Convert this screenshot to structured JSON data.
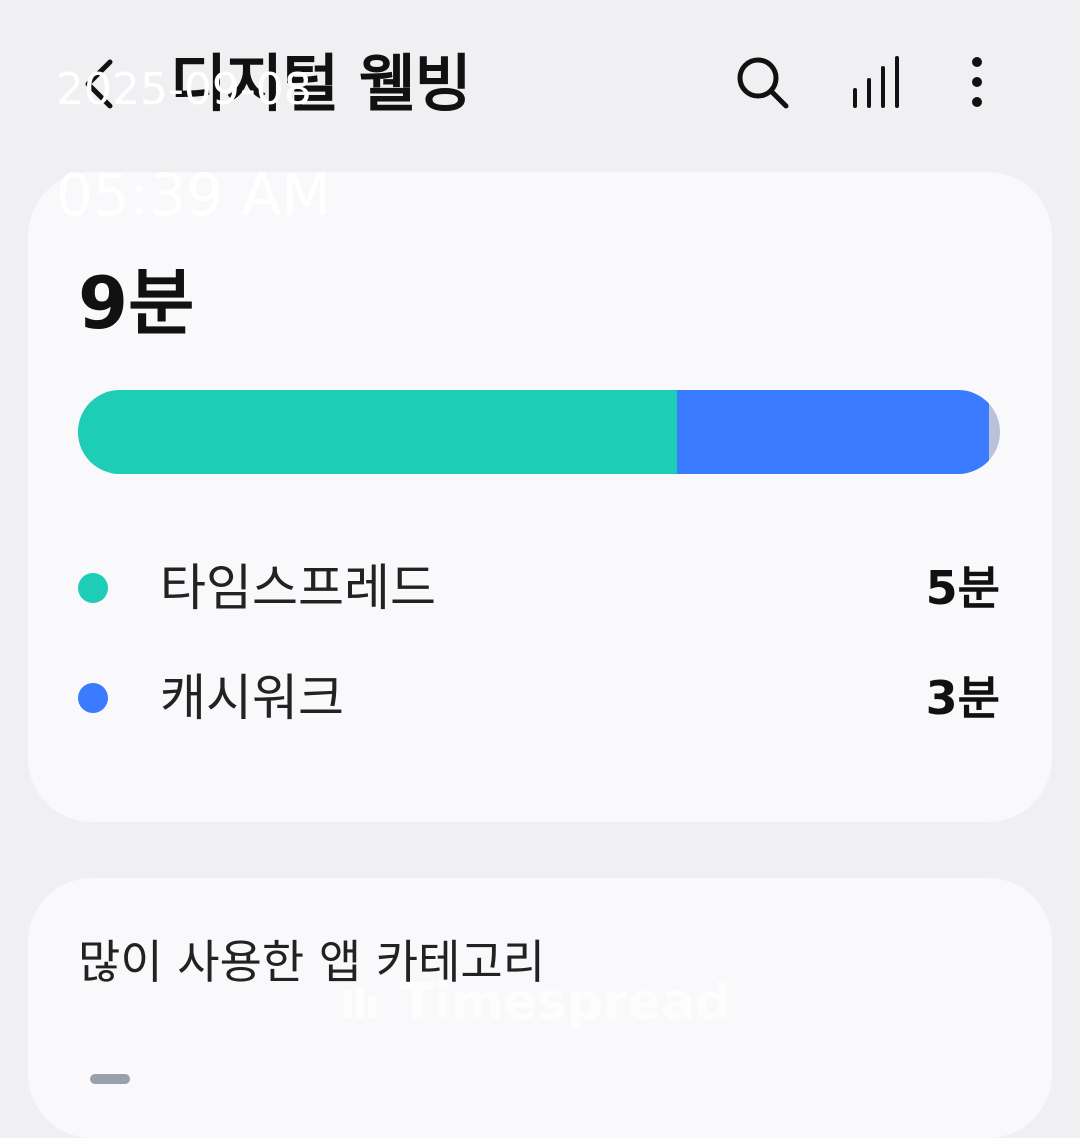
{
  "header": {
    "title": "디지털 웰빙",
    "icons": [
      "back-arrow-icon",
      "search-icon",
      "bar-chart-icon",
      "more-vertical-icon"
    ]
  },
  "timestamp": {
    "date": "2025-09-08",
    "time": "05:39 AM"
  },
  "summary": {
    "total": "9분",
    "segments": [
      {
        "name": "타임스프레드",
        "fraction": 0.65,
        "color": "#1ecdb6"
      },
      {
        "name": "캐시워크",
        "fraction": 0.338,
        "color": "#3b7bff"
      }
    ],
    "remainder_color": "#b9c2d6",
    "legend": [
      {
        "label": "타임스프레드",
        "value": "5분",
        "color": "#1ecdb6"
      },
      {
        "label": "캐시워크",
        "value": "3분",
        "color": "#3b7bff"
      }
    ]
  },
  "categories": {
    "title": "많이 사용한 앱 카테고리"
  },
  "watermark": "Timespread"
}
